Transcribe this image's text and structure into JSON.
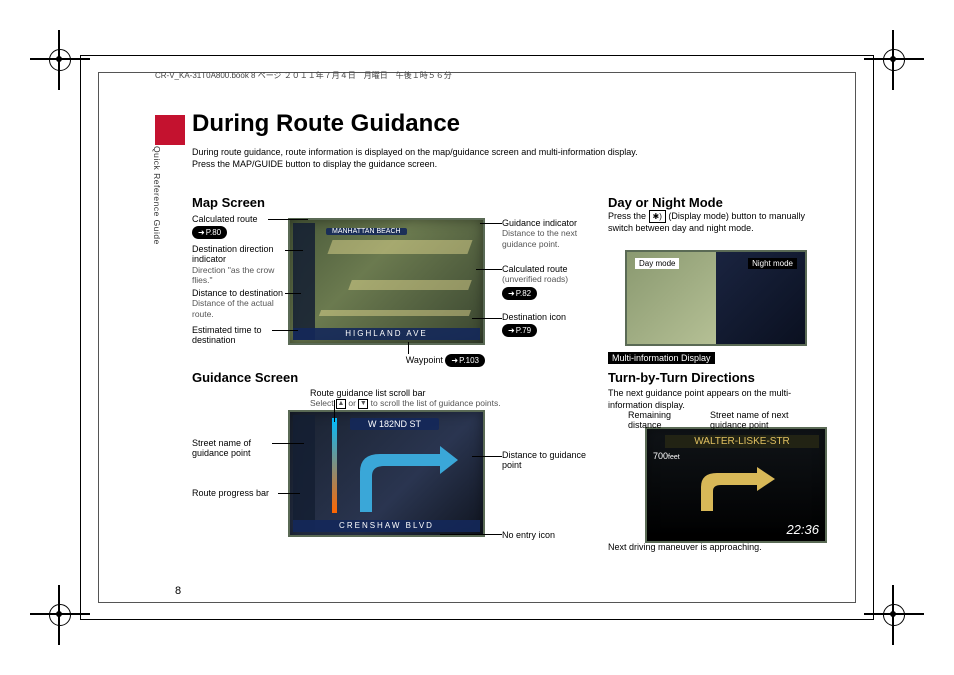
{
  "slug": "CR-V_KA-31T0A800.book  8 ページ  ２０１１年７月４日　月曜日　午後１時５６分",
  "sidetab": "Quick Reference Guide",
  "page_number": "8",
  "title": "During Route Guidance",
  "intro_line1": "During route guidance, route information is displayed on the map/guidance screen and multi-information display.",
  "intro_line2": "Press the MAP/GUIDE button to display the guidance screen.",
  "sections": {
    "map": "Map Screen",
    "guidance": "Guidance Screen",
    "daynight": "Day or Night Mode",
    "turn": "Turn-by-Turn Directions",
    "mid_badge": "Multi-information Display"
  },
  "day_night_text_a": "Press the ",
  "day_night_button": "✱)",
  "day_night_text_b": " (Display mode) button to manually switch between day and night mode.",
  "turn_text": "The next guidance point appears on the multi-information display.",
  "map_labels": {
    "calc_route": {
      "t": "Calculated route",
      "pref": "P.80"
    },
    "dest_dir": {
      "t": "Destination direction indicator",
      "d": "Direction \"as the crow flies.\""
    },
    "dist_dest": {
      "t": "Distance to destination",
      "d": "Distance of the actual route."
    },
    "eta": {
      "t": "Estimated time to destination"
    },
    "waypoint": {
      "t": "Waypoint",
      "pref": "P.103"
    },
    "guide_ind": {
      "t": "Guidance indicator",
      "d": "Distance to the next guidance point."
    },
    "calc_unv": {
      "t": "Calculated route",
      "d": "(unverified roads)",
      "pref": "P.82"
    },
    "dest_icon": {
      "t": "Destination icon",
      "pref": "P.79"
    }
  },
  "guidance_labels": {
    "street": {
      "t": "Street name of guidance point"
    },
    "progress": {
      "t": "Route progress bar"
    },
    "scroll": {
      "t": "Route guidance list scroll bar",
      "d1": "Select ",
      "d2": " or ",
      "d3": " to scroll the list of guidance points."
    },
    "dist": {
      "t": "Distance to guidance point"
    },
    "noentry": {
      "t": "No entry icon"
    }
  },
  "turn_labels": {
    "remain": "Remaining distance",
    "street": "Street name of next guidance point",
    "approach": "Next driving maneuver is approaching."
  },
  "screens": {
    "map_street_top": "MANHATTAN BEACH",
    "map_street_bottom": "HIGHLAND AVE",
    "guidance_street_top": "W 182ND ST",
    "guidance_street_bottom": "CRENSHAW BLVD",
    "day_mode": "Day mode",
    "night_mode": "Night mode",
    "turn_street": "WALTER-LISKE-STR",
    "turn_dist": "700",
    "turn_dist_unit": "feet",
    "turn_clock": "22:36"
  },
  "tri_up": "▲",
  "tri_dn": "▼"
}
